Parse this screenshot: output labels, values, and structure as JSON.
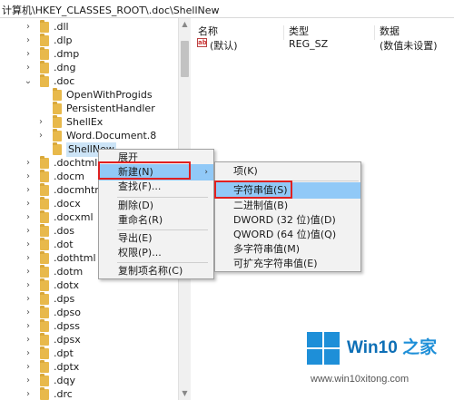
{
  "address_bar": {
    "path": "计算机\\HKEY_CLASSES_ROOT\\.doc\\ShellNew"
  },
  "tree": {
    "items": [
      {
        "label": ".dll",
        "expand": "›"
      },
      {
        "label": ".dlp",
        "expand": "›"
      },
      {
        "label": ".dmp",
        "expand": "›"
      },
      {
        "label": ".dng",
        "expand": "›"
      },
      {
        "label": ".doc",
        "expand": "⌄"
      },
      {
        "label": "OpenWithProgids",
        "expand": ""
      },
      {
        "label": "PersistentHandler",
        "expand": ""
      },
      {
        "label": "ShellEx",
        "expand": "›"
      },
      {
        "label": "Word.Document.8",
        "expand": "›"
      },
      {
        "label": "ShellNew",
        "expand": ""
      },
      {
        "label": ".dochtml",
        "expand": "›"
      },
      {
        "label": ".docm",
        "expand": "›"
      },
      {
        "label": ".docmhtml",
        "expand": "›"
      },
      {
        "label": ".docx",
        "expand": "›"
      },
      {
        "label": ".docxml",
        "expand": "›"
      },
      {
        "label": ".dos",
        "expand": "›"
      },
      {
        "label": ".dot",
        "expand": "›"
      },
      {
        "label": ".dothtml",
        "expand": "›"
      },
      {
        "label": ".dotm",
        "expand": "›"
      },
      {
        "label": ".dotx",
        "expand": "›"
      },
      {
        "label": ".dps",
        "expand": "›"
      },
      {
        "label": ".dpso",
        "expand": "›"
      },
      {
        "label": ".dpss",
        "expand": "›"
      },
      {
        "label": ".dpsx",
        "expand": "›"
      },
      {
        "label": ".dpt",
        "expand": "›"
      },
      {
        "label": ".dptx",
        "expand": "›"
      },
      {
        "label": ".dqy",
        "expand": "›"
      },
      {
        "label": ".drc",
        "expand": "›"
      }
    ]
  },
  "values": {
    "headers": {
      "name": "名称",
      "type": "类型",
      "data": "数据"
    },
    "rows": [
      {
        "icon": "ab",
        "name": "(默认)",
        "type": "REG_SZ",
        "data": "(数值未设置)"
      }
    ]
  },
  "context_menu": {
    "items": [
      {
        "label": "展开"
      },
      {
        "label": "新建(N)",
        "submenu_arrow": "›"
      },
      {
        "label": "查找(F)..."
      },
      {
        "label": "删除(D)"
      },
      {
        "label": "重命名(R)"
      },
      {
        "label": "导出(E)"
      },
      {
        "label": "权限(P)..."
      },
      {
        "label": "复制项名称(C)"
      }
    ]
  },
  "submenu": {
    "items": [
      {
        "label": "项(K)"
      },
      {
        "label": "字符串值(S)"
      },
      {
        "label": "二进制值(B)"
      },
      {
        "label": "DWORD (32 位)值(D)"
      },
      {
        "label": "QWORD (64 位)值(Q)"
      },
      {
        "label": "多字符串值(M)"
      },
      {
        "label": "可扩充字符串值(E)"
      }
    ]
  },
  "watermark": {
    "brand_main": "Win10",
    "brand_accent": " 之家",
    "url": "www.win10xitong.com"
  },
  "colors": {
    "folder": "#e8b94b",
    "highlight": "#91c9f7",
    "annotation_box": "#e02020",
    "brand_blue": "#1e8fd8"
  }
}
